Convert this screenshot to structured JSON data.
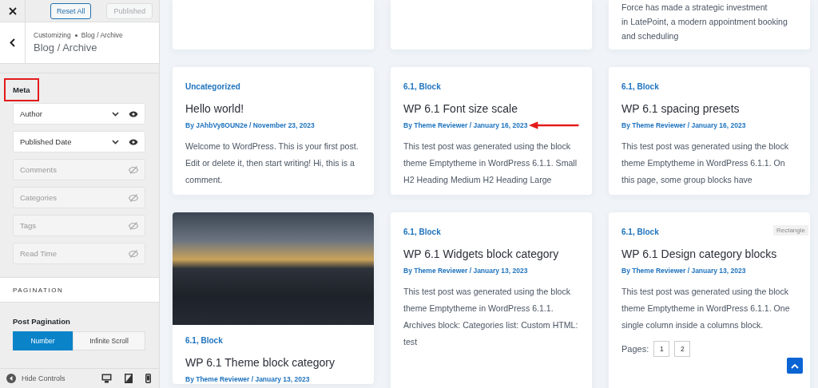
{
  "topbar": {
    "reset_label": "Reset All",
    "publish_label": "Published",
    "publish_disabled": true
  },
  "header": {
    "breadcrumb_root": "Customizing",
    "breadcrumb_current": "Blog / Archive",
    "title": "Blog / Archive"
  },
  "meta_section": {
    "title": "Meta",
    "highlighted": true,
    "items": [
      {
        "label": "Author",
        "visible": true
      },
      {
        "label": "Published Date",
        "visible": true
      },
      {
        "label": "Comments",
        "visible": false
      },
      {
        "label": "Categories",
        "visible": false
      },
      {
        "label": "Tags",
        "visible": false
      },
      {
        "label": "Read Time",
        "visible": false
      }
    ]
  },
  "pagination_section": {
    "heading": "PAGINATION",
    "label": "Post Pagination",
    "options": [
      {
        "label": "Number",
        "selected": true
      },
      {
        "label": "Infinite Scroll",
        "selected": false
      }
    ]
  },
  "footer": {
    "hide_label": "Hide Controls"
  },
  "columns": [
    {
      "posts": [
        {
          "kind": "stub"
        },
        {
          "kind": "post",
          "categories": "Uncategorized",
          "title": "Hello world!",
          "meta": "By JAhbVy8OUN2e / November 23, 2023",
          "excerpt": "Welcome to WordPress. This is your first post. Edit or delete it, then start writing! Hi, this is a comment."
        },
        {
          "kind": "image-post",
          "categories": "6.1, Block",
          "title": "WP 6.1 Theme block category",
          "meta": "By Theme Reviewer / January 13, 2023"
        }
      ]
    },
    {
      "posts": [
        {
          "kind": "stub"
        },
        {
          "kind": "post",
          "categories": "6.1, Block",
          "title": "WP 6.1 Font size scale",
          "meta": "By Theme Reviewer / January 16, 2023",
          "excerpt": "This test post was generated using the block theme Emptytheme in WordPress 6.1.1. Small H2 Heading Medium H2 Heading Large",
          "arrow": true
        },
        {
          "kind": "post",
          "categories": "6.1, Block",
          "title": "WP 6.1 Widgets block category",
          "meta": "By Theme Reviewer / January 13, 2023",
          "excerpt": "This test post was generated using the block theme Emptytheme in WordPress 6.1.1. Archives block: Categories list: Custom HTML: test"
        }
      ]
    },
    {
      "posts": [
        {
          "kind": "stub",
          "lines": [
            "Force has made a strategic investment",
            "in LatePoint, a modern appointment booking",
            "and scheduling"
          ]
        },
        {
          "kind": "post",
          "categories": "6.1, Block",
          "title": "WP 6.1 spacing presets",
          "meta": "By Theme Reviewer / January 16, 2023",
          "excerpt": "This test post was generated using the block theme Emptytheme in WordPress 6.1.1. On this page, some group blocks have"
        },
        {
          "kind": "post",
          "categories": "6.1, Block",
          "title": "WP 6.1 Design category blocks",
          "meta": "By Theme Reviewer / January 13, 2023",
          "excerpt": "This test post was generated using the block theme Emptytheme in WordPress 6.1.1. One single column inside a columns block.",
          "overlay_label": "Rectangle",
          "pages_label": "Pages:",
          "pages": [
            "1",
            "2"
          ]
        }
      ]
    }
  ]
}
